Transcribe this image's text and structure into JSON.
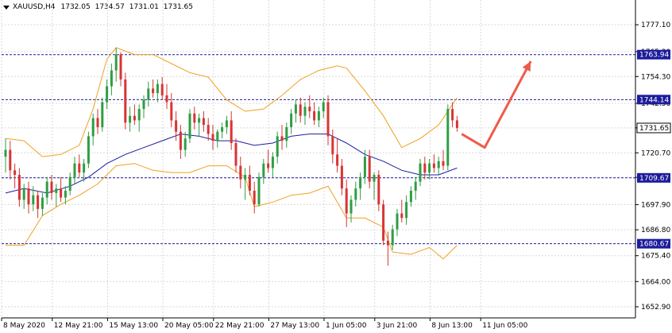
{
  "header": {
    "symbol": "XAUUSD,H4",
    "open": "1732.05",
    "high": "1734.57",
    "low": "1731.01",
    "close": "1731.65"
  },
  "colors": {
    "bull": "#2e9e43",
    "bear": "#d83434",
    "ma": "#1c1c9c",
    "bands": "#f0a020",
    "hline": "#1c1c9c",
    "arrow": "#ef5a4a",
    "grid": "#d9d9d9",
    "axis": "#000000"
  },
  "chart_data": {
    "type": "candlestick",
    "ylim": [
      1648.0,
      1788.0
    ],
    "y_ticks": [
      "1777.10",
      "1765.30",
      "1754.30",
      "1742.50",
      "1731.70",
      "1720.70",
      "1709.90",
      "1697.90",
      "1686.80",
      "1675.40",
      "1664.00",
      "1652.90"
    ],
    "x_ticks": [
      "8 May 2020",
      "12 May 21:00",
      "15 May 13:00",
      "20 May 05:00",
      "22 May 21:00",
      "27 May 13:00",
      "1 Jun 05:00",
      "3 Jun 21:00",
      "8 Jun 13:00",
      "11 Jun 05:00"
    ],
    "horizontal_levels": [
      {
        "value": 1763.94,
        "label": "1763.94"
      },
      {
        "value": 1744.14,
        "label": "1744.14"
      },
      {
        "value": 1709.67,
        "label": "1709.67"
      },
      {
        "value": 1680.67,
        "label": "1680.67"
      }
    ],
    "current_price": {
      "value": 1731.65,
      "label": "1731.65"
    },
    "candles": [
      [
        1719,
        1727,
        1712,
        1722
      ],
      [
        1722,
        1726,
        1709,
        1713
      ],
      [
        1713,
        1716,
        1705,
        1711
      ],
      [
        1711,
        1714,
        1697,
        1700
      ],
      [
        1700,
        1707,
        1696,
        1705
      ],
      [
        1705,
        1708,
        1694,
        1698
      ],
      [
        1698,
        1706,
        1695,
        1702
      ],
      [
        1702,
        1704,
        1692,
        1696
      ],
      [
        1696,
        1703,
        1693,
        1701
      ],
      [
        1701,
        1710,
        1698,
        1708
      ],
      [
        1708,
        1711,
        1700,
        1703
      ],
      [
        1703,
        1707,
        1697,
        1705
      ],
      [
        1705,
        1710,
        1699,
        1701
      ],
      [
        1701,
        1706,
        1698,
        1704
      ],
      [
        1704,
        1712,
        1702,
        1710
      ],
      [
        1710,
        1719,
        1707,
        1716
      ],
      [
        1716,
        1720,
        1710,
        1712
      ],
      [
        1712,
        1718,
        1708,
        1716
      ],
      [
        1716,
        1730,
        1714,
        1728
      ],
      [
        1728,
        1738,
        1724,
        1736
      ],
      [
        1736,
        1740,
        1729,
        1732
      ],
      [
        1732,
        1745,
        1730,
        1743
      ],
      [
        1743,
        1753,
        1740,
        1750
      ],
      [
        1750,
        1760,
        1746,
        1757
      ],
      [
        1757,
        1767,
        1752,
        1764
      ],
      [
        1764,
        1765,
        1750,
        1753
      ],
      [
        1753,
        1756,
        1731,
        1734
      ],
      [
        1734,
        1741,
        1730,
        1737
      ],
      [
        1737,
        1742,
        1733,
        1735
      ],
      [
        1735,
        1742,
        1730,
        1740
      ],
      [
        1740,
        1746,
        1736,
        1744
      ],
      [
        1744,
        1752,
        1741,
        1749
      ],
      [
        1749,
        1753,
        1745,
        1747
      ],
      [
        1747,
        1753,
        1743,
        1751
      ],
      [
        1751,
        1754,
        1744,
        1746
      ],
      [
        1746,
        1751,
        1740,
        1743
      ],
      [
        1743,
        1747,
        1732,
        1735
      ],
      [
        1735,
        1739,
        1726,
        1730
      ],
      [
        1730,
        1733,
        1718,
        1722
      ],
      [
        1722,
        1730,
        1719,
        1727
      ],
      [
        1727,
        1740,
        1725,
        1738
      ],
      [
        1738,
        1741,
        1731,
        1734
      ],
      [
        1734,
        1738,
        1728,
        1736
      ],
      [
        1736,
        1739,
        1730,
        1733
      ],
      [
        1733,
        1736,
        1726,
        1729
      ],
      [
        1729,
        1733,
        1722,
        1726
      ],
      [
        1726,
        1731,
        1723,
        1730
      ],
      [
        1730,
        1734,
        1727,
        1732
      ],
      [
        1732,
        1737,
        1729,
        1735
      ],
      [
        1735,
        1739,
        1722,
        1725
      ],
      [
        1725,
        1727,
        1712,
        1715
      ],
      [
        1715,
        1719,
        1705,
        1709
      ],
      [
        1709,
        1714,
        1700,
        1711
      ],
      [
        1711,
        1715,
        1702,
        1704
      ],
      [
        1704,
        1708,
        1694,
        1698
      ],
      [
        1698,
        1712,
        1697,
        1710
      ],
      [
        1710,
        1718,
        1707,
        1716
      ],
      [
        1716,
        1722,
        1712,
        1714
      ],
      [
        1714,
        1721,
        1710,
        1719
      ],
      [
        1719,
        1730,
        1716,
        1728
      ],
      [
        1728,
        1733,
        1722,
        1726
      ],
      [
        1726,
        1734,
        1723,
        1732
      ],
      [
        1732,
        1740,
        1729,
        1738
      ],
      [
        1738,
        1744,
        1734,
        1742
      ],
      [
        1742,
        1745,
        1734,
        1737
      ],
      [
        1737,
        1743,
        1733,
        1741
      ],
      [
        1741,
        1746,
        1736,
        1739
      ],
      [
        1739,
        1743,
        1733,
        1735
      ],
      [
        1735,
        1741,
        1732,
        1739
      ],
      [
        1739,
        1745,
        1736,
        1743
      ],
      [
        1743,
        1746,
        1724,
        1728
      ],
      [
        1728,
        1731,
        1716,
        1720
      ],
      [
        1720,
        1727,
        1712,
        1715
      ],
      [
        1715,
        1718,
        1702,
        1705
      ],
      [
        1705,
        1709,
        1688,
        1694
      ],
      [
        1694,
        1702,
        1690,
        1700
      ],
      [
        1700,
        1708,
        1697,
        1705
      ],
      [
        1705,
        1712,
        1700,
        1710
      ],
      [
        1710,
        1722,
        1707,
        1719
      ],
      [
        1719,
        1722,
        1705,
        1708
      ],
      [
        1708,
        1712,
        1700,
        1711
      ],
      [
        1711,
        1713,
        1695,
        1698
      ],
      [
        1698,
        1700,
        1680,
        1682
      ],
      [
        1682,
        1686,
        1671,
        1680
      ],
      [
        1680,
        1689,
        1678,
        1687
      ],
      [
        1687,
        1696,
        1684,
        1694
      ],
      [
        1694,
        1700,
        1690,
        1692
      ],
      [
        1692,
        1702,
        1689,
        1699
      ],
      [
        1699,
        1706,
        1697,
        1704
      ],
      [
        1704,
        1710,
        1700,
        1708
      ],
      [
        1708,
        1718,
        1706,
        1716
      ],
      [
        1716,
        1719,
        1709,
        1712
      ],
      [
        1712,
        1718,
        1709,
        1716
      ],
      [
        1716,
        1720,
        1712,
        1714
      ],
      [
        1714,
        1719,
        1711,
        1717
      ],
      [
        1717,
        1722,
        1713,
        1715
      ],
      [
        1715,
        1742,
        1713,
        1740
      ],
      [
        1740,
        1743,
        1732,
        1735
      ],
      [
        1735,
        1737,
        1730,
        1731.65
      ]
    ],
    "ma_line": [
      [
        0,
        1703
      ],
      [
        4,
        1705
      ],
      [
        9,
        1703
      ],
      [
        14,
        1706
      ],
      [
        18,
        1710
      ],
      [
        22,
        1716
      ],
      [
        26,
        1720
      ],
      [
        30,
        1723
      ],
      [
        34,
        1726
      ],
      [
        38,
        1729
      ],
      [
        42,
        1728
      ],
      [
        46,
        1726
      ],
      [
        50,
        1726
      ],
      [
        54,
        1724
      ],
      [
        58,
        1725
      ],
      [
        62,
        1728
      ],
      [
        66,
        1729
      ],
      [
        70,
        1729
      ],
      [
        74,
        1725
      ],
      [
        78,
        1720
      ],
      [
        82,
        1717
      ],
      [
        86,
        1713
      ],
      [
        90,
        1711
      ],
      [
        94,
        1711
      ],
      [
        98,
        1714
      ]
    ],
    "upper_band": [
      [
        0,
        1727
      ],
      [
        4,
        1726
      ],
      [
        8,
        1719
      ],
      [
        12,
        1720
      ],
      [
        16,
        1724
      ],
      [
        19,
        1740
      ],
      [
        22,
        1762
      ],
      [
        24,
        1767
      ],
      [
        28,
        1764
      ],
      [
        32,
        1764
      ],
      [
        36,
        1760
      ],
      [
        40,
        1756
      ],
      [
        44,
        1754
      ],
      [
        48,
        1744
      ],
      [
        52,
        1739
      ],
      [
        56,
        1740
      ],
      [
        60,
        1746
      ],
      [
        64,
        1753
      ],
      [
        68,
        1757
      ],
      [
        72,
        1759
      ],
      [
        74,
        1758
      ],
      [
        78,
        1748
      ],
      [
        82,
        1737
      ],
      [
        86,
        1723
      ],
      [
        90,
        1727
      ],
      [
        94,
        1733
      ],
      [
        98,
        1745
      ]
    ],
    "lower_band": [
      [
        0,
        1680
      ],
      [
        4,
        1680
      ],
      [
        8,
        1693
      ],
      [
        12,
        1698
      ],
      [
        16,
        1702
      ],
      [
        20,
        1707
      ],
      [
        24,
        1715
      ],
      [
        28,
        1716
      ],
      [
        32,
        1713
      ],
      [
        36,
        1712
      ],
      [
        40,
        1712
      ],
      [
        44,
        1715
      ],
      [
        48,
        1715
      ],
      [
        52,
        1710
      ],
      [
        54,
        1697
      ],
      [
        58,
        1699
      ],
      [
        62,
        1702
      ],
      [
        66,
        1703
      ],
      [
        70,
        1706
      ],
      [
        74,
        1692
      ],
      [
        78,
        1692
      ],
      [
        82,
        1688
      ],
      [
        84,
        1677
      ],
      [
        88,
        1676
      ],
      [
        92,
        1679
      ],
      [
        95,
        1674
      ],
      [
        98,
        1680
      ]
    ],
    "forecast_arrow": [
      [
        99,
        1729
      ],
      [
        104,
        1723
      ],
      [
        114,
        1761
      ]
    ]
  }
}
